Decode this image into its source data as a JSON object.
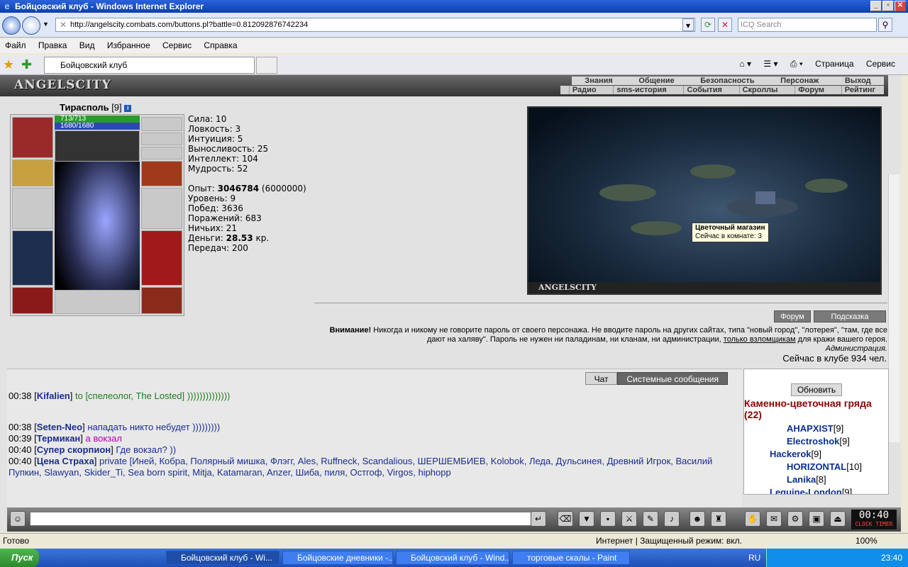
{
  "window": {
    "title": "Бойцовский клуб - Windows Internet Explorer"
  },
  "address": {
    "url": "http://angelscity.combats.com/buttons.pl?battle=0.812092876742234",
    "search_placeholder": "ICQ Search"
  },
  "menu": [
    "Файл",
    "Правка",
    "Вид",
    "Избранное",
    "Сервис",
    "Справка"
  ],
  "tab": {
    "title": "Бойцовский клуб"
  },
  "tabtools": {
    "page": "Страница",
    "service": "Сервис"
  },
  "game": {
    "logo": "ANGELSCITY",
    "menu1": [
      "Знания",
      "Общение",
      "Безопасность",
      "Персонаж",
      "Выход"
    ],
    "menu2": [
      "Радио",
      "sms-история",
      "События",
      "Скроллы",
      "Форум",
      "Рейтинг"
    ],
    "character": {
      "name": "Тирасполь",
      "level": "[9]",
      "hp": "713/713",
      "mana": "1680/1680"
    },
    "stats": {
      "strength": "Сила: 10",
      "agility": "Ловкость: 3",
      "intuition": "Интуиция: 5",
      "endurance": "Выносливость: 25",
      "intellect": "Интеллект: 104",
      "wisdom": "Мудрость: 52",
      "exp_label": "Опыт:",
      "exp": "3046784",
      "exp_next": "(6000000)",
      "level": "Уровень: 9",
      "wins": "Побед: 3636",
      "losses": "Поражений: 683",
      "draws": "Ничьих: 21",
      "money_label": "Деньги:",
      "money": "28.53",
      "money_unit": "кр.",
      "transfers": "Передач: 200"
    },
    "map": {
      "footer": "ANGELSCITY",
      "tooltip_title": "Цветочный магазин",
      "tooltip_text": "Сейчас в комнате: 3"
    },
    "buttons": {
      "forum": "Форум",
      "hint": "Подсказка"
    },
    "warning": {
      "title": "Внимание!",
      "text": " Никогда и никому не говорите пароль от своего персонажа. Не вводите пароль на других сайтах, типа \"новый город\", \"лотерея\", \"там, где все дают на халяву\". Пароль не нужен ни паладинам, ни кланам, ни администрации,",
      "link": "только взломщикам",
      "tail": " для кражи вашего героя.",
      "sig": "Администрация."
    },
    "online": "Сейчас в клубе 934 чел."
  },
  "chat": {
    "tabs": [
      "Чат",
      "Системные сообщения"
    ],
    "messages": [
      {
        "time": "00:38",
        "nick": "Kifalien",
        "text": " to [спелеолог, The Losted] ))))))))))))))",
        "color": "#1f7a1f"
      },
      {
        "time": "00:38",
        "nick": "Seten-Neo",
        "text": " нападать никто небудет      )))))))))",
        "color": "#1a2d8f"
      },
      {
        "time": "00:39",
        "nick": "Термикан",
        "text": " а вокзал",
        "color": "#b000b0"
      },
      {
        "time": "00:40",
        "nick": "Супер скорпион",
        "text": " Где вокзал? ))",
        "color": "#1a2d8f"
      },
      {
        "time": "00:40",
        "nick": "Цена Страха",
        "text": " private [Иней, Кобра, Полярный мишка, Флэгг, Ales, Ruffneck, Scandalious, ШЕРШЕМБИЕВ, Kolobok, Леда, Дульсинея, Древний Игрок, Василий Пупкин, Slawyan, Skider_Ti, Sea born spirit, Mitja, Katamaran, Anzer, Шиба, пиля, Остгоф, Virgos, hiphopp",
        "color": "#1a2d8f"
      }
    ]
  },
  "roster": {
    "refresh": "Обновить",
    "location": "Каменно-цветочная гряда (22)",
    "users": [
      {
        "name": "AHAPXIST",
        "level": "[9]"
      },
      {
        "name": "Electroshok",
        "level": "[9]"
      },
      {
        "name": "Hackerok",
        "level": "[9]"
      },
      {
        "name": "HORIZONTAL",
        "level": "[10]"
      },
      {
        "name": "Lanika",
        "level": "[8]"
      },
      {
        "name": "Leguine-London",
        "level": "[9]"
      }
    ]
  },
  "clock": {
    "time": "00:40",
    "label": "CLOCK TIMER"
  },
  "statusbar": {
    "left": "Готово",
    "zone": "Интернет | Защищенный режим: вкл.",
    "zoom": "100%"
  },
  "taskbar": {
    "start": "Пуск",
    "tasks": [
      "Бойцовский клуб - Wi...",
      "Бойцовские дневники -...",
      "Бойцовский клуб - Wind...",
      "торговые скалы - Paint"
    ],
    "lang": "RU",
    "time": "23:40"
  }
}
